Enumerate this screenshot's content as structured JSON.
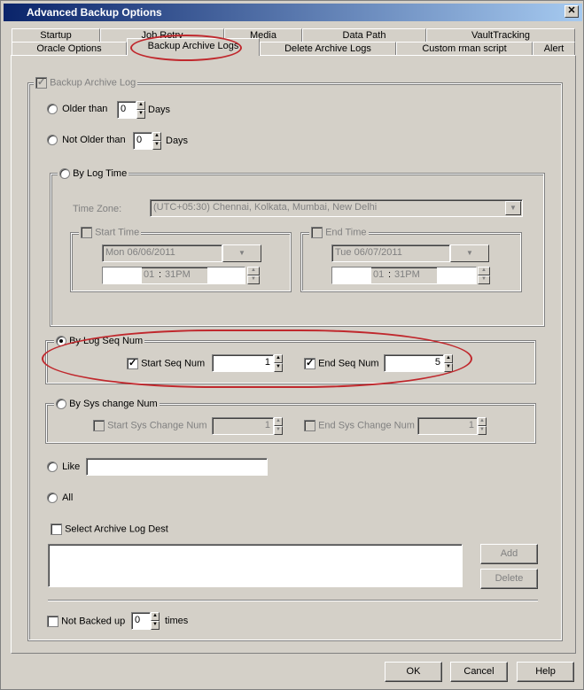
{
  "window": {
    "title": "Advanced Backup Options",
    "close_glyph": "✕"
  },
  "tabs_row1": [
    {
      "label": "Startup"
    },
    {
      "label": "Job Retry"
    },
    {
      "label": "Media"
    },
    {
      "label": "Data Path"
    },
    {
      "label": "VaultTracking"
    }
  ],
  "tabs_row2": [
    {
      "label": "Oracle Options"
    },
    {
      "label": "Backup Archive Logs"
    },
    {
      "label": "Delete Archive Logs"
    },
    {
      "label": "Custom rman script"
    },
    {
      "label": "Alert"
    }
  ],
  "active_tab": "Backup Archive Logs",
  "backup_archive_log": {
    "label": "Backup Archive Log",
    "checked": true
  },
  "older_than": {
    "label": "Older than",
    "value": "0",
    "unit": "Days"
  },
  "not_older_than": {
    "label": "Not Older than",
    "value": "0",
    "unit": "Days"
  },
  "by_log_time": {
    "label": "By Log Time",
    "time_zone_label": "Time Zone:",
    "time_zone_value": "(UTC+05:30) Chennai, Kolkata, Mumbai, New Delhi",
    "start_time": {
      "label": "Start Time",
      "date": "Mon 06/06/2011",
      "hour": "01",
      "minute": "31PM"
    },
    "end_time": {
      "label": "End Time",
      "date": "Tue 06/07/2011",
      "hour": "01",
      "minute": "31PM"
    }
  },
  "by_log_seq_num": {
    "label": "By Log Seq Num",
    "selected": true,
    "start_label": "Start Seq Num",
    "start_value": "1",
    "end_label": "End Seq Num",
    "end_value": "5"
  },
  "by_sys_change_num": {
    "label": "By Sys change Num",
    "start_label": "Start Sys Change Num",
    "start_value": "1",
    "end_label": "End Sys Change Num",
    "end_value": "1"
  },
  "like": {
    "label": "Like",
    "value": ""
  },
  "all": {
    "label": "All"
  },
  "select_archive_log_dest": {
    "label": "Select Archive Log Dest"
  },
  "dest_buttons": {
    "add": "Add",
    "delete": "Delete"
  },
  "not_backed_up": {
    "label": "Not Backed up",
    "value": "0",
    "unit": "times"
  },
  "footer": {
    "ok": "OK",
    "cancel": "Cancel",
    "help": "Help"
  },
  "glyphs": {
    "up": "▲",
    "down": "▼",
    "check": "✓"
  },
  "colors": {
    "title_start": "#0a246a",
    "title_end": "#a6caf0",
    "highlight": "#c0282d"
  }
}
